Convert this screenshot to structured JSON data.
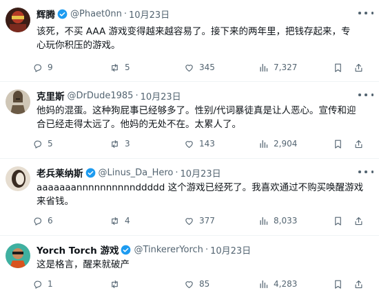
{
  "tweets": [
    {
      "name": "辉腾",
      "handle": "@Phaet0nn",
      "dot": "·",
      "date": "10月23日",
      "text": "该死，不买 AAA 游戏变得越来越容易了。接下来的两年里，把钱存起来，专\n心玩你积压的游戏。",
      "replies": "9",
      "retweets": "5",
      "likes": "345",
      "views": "7,327",
      "avatar_color": "#8a2a1e"
    },
    {
      "name": "克里斯",
      "handle": "@DrDude1985",
      "dot": "·",
      "date": "10月23日",
      "text": "他妈的混蛋。这种狗屁事已经够多了。性别/代词暴徒真是让人恶心。宣传和迎\n合已经走得太远了。他妈的无处不在。太累人了。",
      "replies": "5",
      "retweets": "3",
      "likes": "143",
      "views": "2,904",
      "avatar_color": "#6b5a45"
    },
    {
      "name": "老兵莱纳斯",
      "handle": "@Linus_Da_Hero",
      "dot": "·",
      "date": "10月23日",
      "text": "aaaaaaannnnnnnnnnddddd 这个游戏已经死了。我喜欢通过不购买唤醒游戏\n来省钱。",
      "replies": "6",
      "retweets": "4",
      "likes": "377",
      "views": "8,033",
      "avatar_color": "#d9cfc2"
    },
    {
      "name": "Yorch Torch 游戏",
      "handle": "@TinkererYorch",
      "dot": "·",
      "date": "10月23日",
      "text": "这是格言，醒来就破产",
      "replies": "1",
      "retweets": "",
      "likes": "85",
      "views": "4,283",
      "avatar_color": "#2e7d6f"
    }
  ],
  "colors": {
    "verified": "#1d9bf0",
    "muted": "#536471",
    "text": "#0f1419",
    "divider": "#eff3f4"
  },
  "icons": [
    "verified-badge-icon",
    "more-icon",
    "reply-icon",
    "retweet-icon",
    "like-icon",
    "views-icon",
    "bookmark-icon",
    "share-icon"
  ]
}
